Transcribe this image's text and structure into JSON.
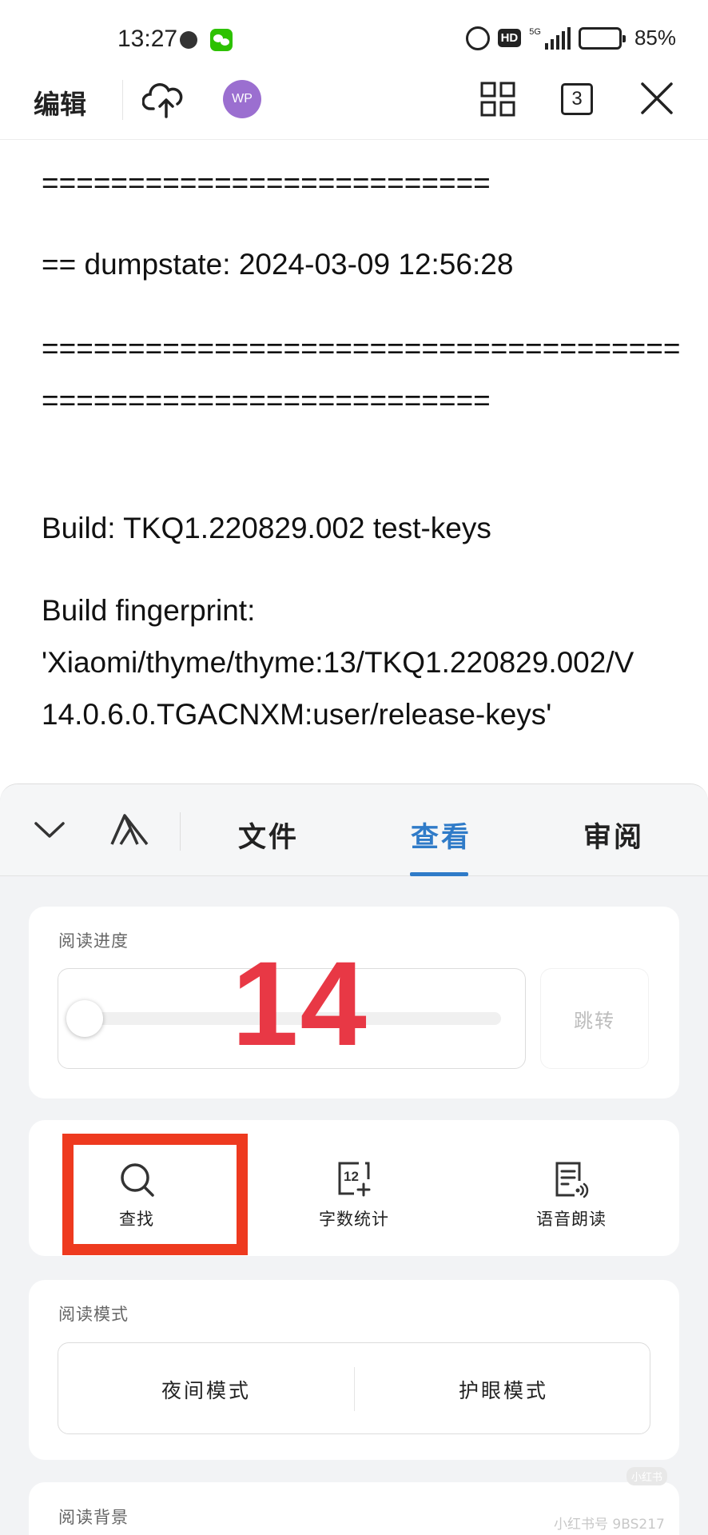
{
  "status_bar": {
    "time": "13:27",
    "network": "5G",
    "battery_percent": "85%",
    "hd_badge": "HD",
    "battery_level": 0.85
  },
  "toolbar": {
    "edit_label": "编辑",
    "avatar_initials": "WP",
    "tab_count": "3",
    "avatar_color": "#9b6fd0"
  },
  "document": {
    "lines": [
      "==========================",
      "== dumpstate: 2024-03-09 12:56:28",
      "=====================================",
      "==========================",
      "Build: TKQ1.220829.002 test-keys",
      "Build fingerprint:",
      "'Xiaomi/thyme/thyme:13/TKQ1.220829.002/V",
      "14.0.6.0.TGACNXM:user/release-keys'"
    ]
  },
  "panel": {
    "tabs": {
      "file": "文件",
      "view": "查看",
      "review": "审阅",
      "active": "view"
    },
    "accent_color": "#2f7bc8",
    "reading_progress": {
      "title": "阅读进度",
      "jump_label": "跳转",
      "progress": 0
    },
    "annotation_number": "14",
    "tools": {
      "find": "查找",
      "word_count": "字数统计",
      "read_aloud": "语音朗读"
    },
    "reading_mode": {
      "title": "阅读模式",
      "night": "夜间模式",
      "eye_care": "护眼模式"
    },
    "reading_background": {
      "title": "阅读背景"
    }
  },
  "watermark": {
    "text": "小红书号 9BS217",
    "badge": "小红书"
  },
  "icons": {
    "alarm": "alarm-icon",
    "cloud_upload": "cloud-upload-icon",
    "grid": "grid-icon",
    "close": "close-icon",
    "collapse": "chevron-down-icon",
    "font": "font-style-icon",
    "search": "search-icon",
    "word_count": "word-count-icon",
    "read_aloud": "read-aloud-icon"
  }
}
